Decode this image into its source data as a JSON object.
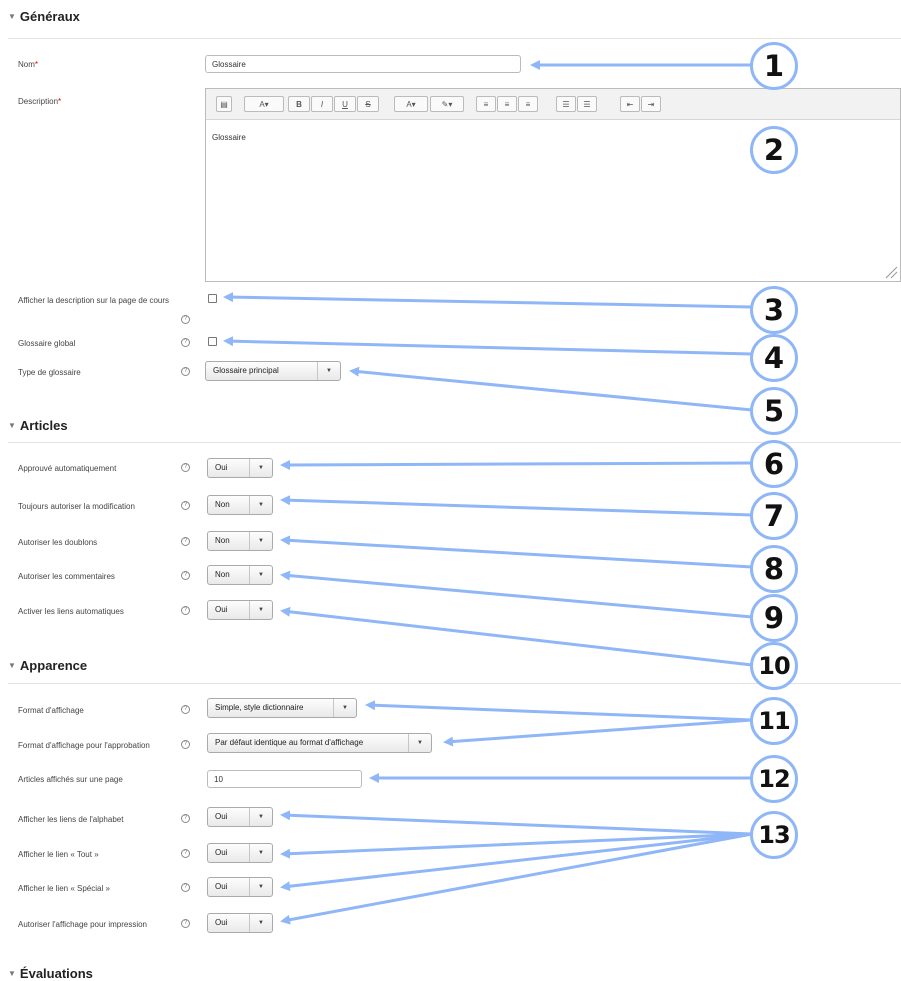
{
  "sections": {
    "generaux": "Généraux",
    "articles": "Articles",
    "apparence": "Apparence",
    "evaluations": "Évaluations"
  },
  "general": {
    "nom_label": "Nom",
    "nom_value": "Glossaire",
    "description_label": "Description",
    "description_text": "Glossaire",
    "show_description_label": "Afficher la description sur la page de cours",
    "global_label": "Glossaire global",
    "type_label": "Type de glossaire",
    "type_value": "Glossaire principal"
  },
  "editor_toolbar": [
    "▤",
    "A▾",
    "B",
    "I",
    "U",
    "S",
    "A▾",
    "✎▾",
    "≡",
    "≡",
    "≡",
    "☰",
    "☰",
    "⇤",
    "⇥"
  ],
  "articles": {
    "auto_approve_label": "Approuvé automatiquement",
    "auto_approve_value": "Oui",
    "allow_edit_label": "Toujours autoriser la modification",
    "allow_edit_value": "Non",
    "duplicates_label": "Autoriser les doublons",
    "duplicates_value": "Non",
    "comments_label": "Autoriser les commentaires",
    "comments_value": "Non",
    "autolink_label": "Activer les liens automatiques",
    "autolink_value": "Oui"
  },
  "apparence": {
    "format_label": "Format d'affichage",
    "format_value": "Simple, style dictionnaire",
    "approval_format_label": "Format d'affichage pour l'approbation",
    "approval_format_value": "Par défaut identique au format d'affichage",
    "per_page_label": "Articles affichés sur une page",
    "per_page_value": "10",
    "alphabet_label": "Afficher les liens de l'alphabet",
    "alphabet_value": "Oui",
    "all_label": "Afficher le lien « Tout »",
    "all_value": "Oui",
    "special_label": "Afficher le lien « Spécial »",
    "special_value": "Oui",
    "print_label": "Autoriser l'affichage pour impression",
    "print_value": "Oui"
  },
  "annotations": [
    "1",
    "2",
    "3",
    "4",
    "5",
    "6",
    "7",
    "8",
    "9",
    "10",
    "11",
    "12",
    "13"
  ],
  "colors": {
    "arrow": "#8fb6f7",
    "required": "#cc0000"
  }
}
